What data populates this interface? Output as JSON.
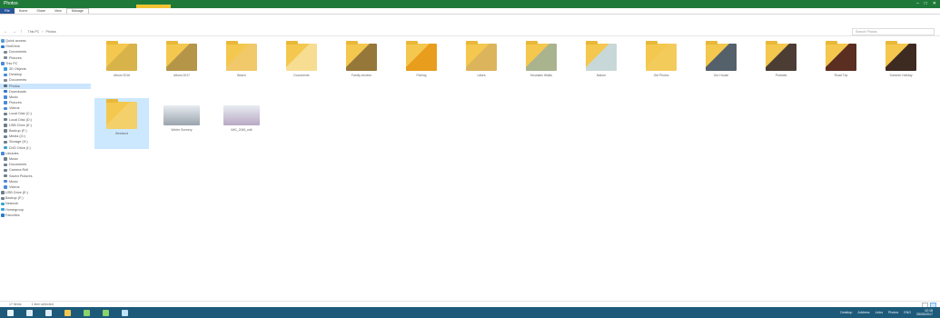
{
  "window": {
    "title": "Photos",
    "tools_label": "Picture Tools"
  },
  "ribbon": {
    "tabs": [
      "File",
      "Home",
      "Share",
      "View",
      "Manage"
    ],
    "active_index": 4
  },
  "address": {
    "back": "←",
    "forward": "→",
    "up": "↑",
    "crumbs": [
      "This PC",
      "Photos"
    ],
    "search_placeholder": "Search Photos"
  },
  "sidebar": {
    "items": [
      {
        "label": "Quick access",
        "level": 0,
        "color": "#5b9bd5"
      },
      {
        "label": "OneDrive",
        "level": 0,
        "color": "#2b79d1"
      },
      {
        "label": "Documents",
        "level": 1,
        "color": "#7b8a97"
      },
      {
        "label": "Pictures",
        "level": 1,
        "color": "#7b8a97"
      },
      {
        "label": "This PC",
        "level": 0,
        "color": "#4a89dc"
      },
      {
        "label": "3D Objects",
        "level": 1,
        "color": "#3aa0d8"
      },
      {
        "label": "Desktop",
        "level": 1,
        "color": "#4a89dc"
      },
      {
        "label": "Documents",
        "level": 1,
        "color": "#7b8a97"
      },
      {
        "label": "Photos",
        "level": 1,
        "color": "#5a6c7a"
      },
      {
        "label": "Downloads",
        "level": 1,
        "color": "#2b79d1"
      },
      {
        "label": "Music",
        "level": 1,
        "color": "#4a89dc"
      },
      {
        "label": "Pictures",
        "level": 1,
        "color": "#4a89dc"
      },
      {
        "label": "Videos",
        "level": 1,
        "color": "#4a89dc"
      },
      {
        "label": "Local Disk (C:)",
        "level": 1,
        "color": "#6f7f8c"
      },
      {
        "label": "Local Disk (D:)",
        "level": 1,
        "color": "#6f7f8c"
      },
      {
        "label": "USB Drive (E:)",
        "level": 1,
        "color": "#6f7f8c"
      },
      {
        "label": "Backup (F:)",
        "level": 1,
        "color": "#6f7f8c"
      },
      {
        "label": "Media (G:)",
        "level": 1,
        "color": "#6f7f8c"
      },
      {
        "label": "Storage (H:)",
        "level": 1,
        "color": "#6f7f8c"
      },
      {
        "label": "DVD Drive (I:)",
        "level": 1,
        "color": "#3aa0d8"
      },
      {
        "label": "Libraries",
        "level": 0,
        "color": "#4a89dc"
      },
      {
        "label": "Music",
        "level": 1,
        "color": "#6f7f8c"
      },
      {
        "label": "Documents",
        "level": 1,
        "color": "#6f7f8c"
      },
      {
        "label": "Camera Roll",
        "level": 1,
        "color": "#6f7f8c"
      },
      {
        "label": "Saved Pictures",
        "level": 1,
        "color": "#6f7f8c"
      },
      {
        "label": "Music",
        "level": 1,
        "color": "#4a89dc"
      },
      {
        "label": "Videos",
        "level": 1,
        "color": "#4a89dc"
      },
      {
        "label": "USB Drive (E:)",
        "level": 0,
        "color": "#6f7f8c"
      },
      {
        "label": "Backup (F:)",
        "level": 0,
        "color": "#6f7f8c"
      },
      {
        "label": "Network",
        "level": 0,
        "color": "#3aa0d8"
      },
      {
        "label": "Homegroup",
        "level": 0,
        "color": "#3aa0d8"
      },
      {
        "label": "Favorites",
        "level": 0,
        "color": "#2b79d1"
      }
    ],
    "selected_index": 8
  },
  "files": [
    {
      "label": "Album 2016",
      "type": "folder",
      "color": "#d8b34a"
    },
    {
      "label": "Album 2017",
      "type": "folder",
      "color": "#b59548"
    },
    {
      "label": "Beach",
      "type": "folder",
      "color": "#f1c96b"
    },
    {
      "label": "Documents",
      "type": "folder",
      "color": "#f7dd92"
    },
    {
      "label": "Family Archive",
      "type": "folder",
      "color": "#96773a"
    },
    {
      "label": "Fishing",
      "type": "folder",
      "color": "#e89d1d"
    },
    {
      "label": "Lakes",
      "type": "folder",
      "color": "#dbb45c"
    },
    {
      "label": "Mountain Walks",
      "type": "folder",
      "color": "#a9b38e"
    },
    {
      "label": "Nature",
      "type": "folder",
      "color": "#c8d8d8"
    },
    {
      "label": "Old Photos",
      "type": "folder",
      "color": "#f3cb5b"
    },
    {
      "label": "Our House",
      "type": "folder",
      "color": "#54606a"
    },
    {
      "label": "Portraits",
      "type": "folder",
      "color": "#4b3d33"
    },
    {
      "label": "Road Trip",
      "type": "folder",
      "color": "#5b2e22"
    },
    {
      "label": "Summer Holiday",
      "type": "folder",
      "color": "#3d2a20"
    },
    {
      "label": "Weekend",
      "type": "folder",
      "color": "#f4d06a",
      "selected": true
    },
    {
      "label": "Winter Scenery",
      "type": "photo",
      "color": "#9aa3ad"
    },
    {
      "label": "IMG_2045_edit",
      "type": "photo",
      "color": "#b9a8c5"
    }
  ],
  "status": {
    "count": "17 items",
    "selected": "1 item selected"
  },
  "taskbar": {
    "apps": [
      {
        "name": "start-icon",
        "color": "#e9f3fa"
      },
      {
        "name": "search-icon",
        "color": "#dcecf6"
      },
      {
        "name": "task-view-icon",
        "color": "#dcecf6"
      },
      {
        "name": "file-explorer-icon",
        "color": "#f3c64f"
      },
      {
        "name": "store-icon",
        "color": "#8bd36b"
      },
      {
        "name": "mail-icon",
        "color": "#8bd36b"
      },
      {
        "name": "photos-icon",
        "color": "#bfe3f7"
      }
    ],
    "tray": [
      "Desktop",
      "Address",
      "Links",
      "Photos",
      "ENG"
    ],
    "time": "12:18",
    "date": "25/05/2017"
  }
}
